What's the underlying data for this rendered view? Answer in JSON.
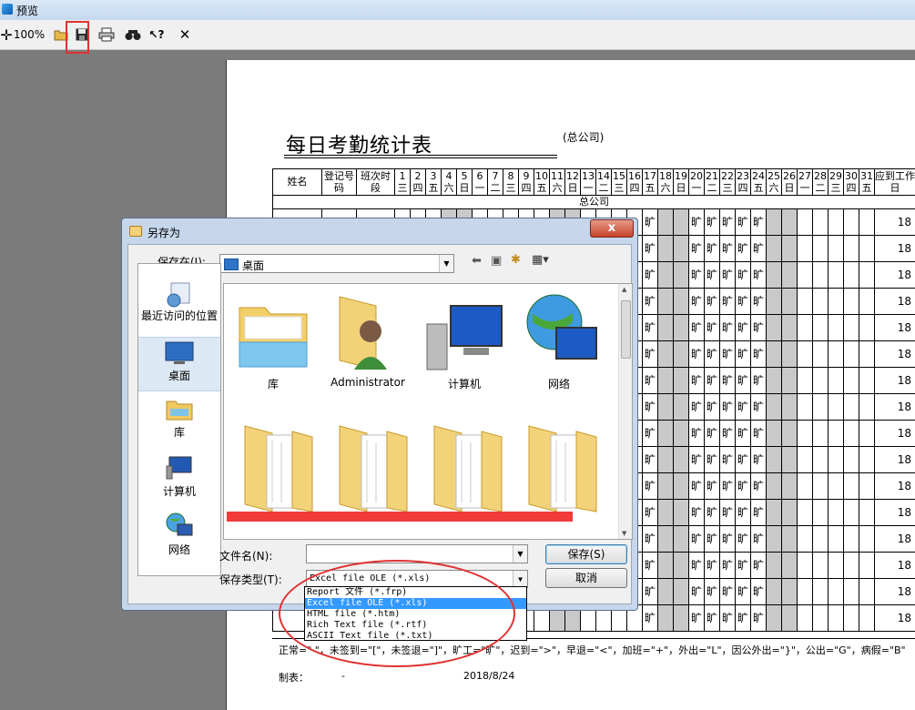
{
  "window": {
    "title": "预览"
  },
  "toolbar": {
    "zoom": "100%",
    "colors": {
      "highlight": "#e03131"
    }
  },
  "report": {
    "title": "每日考勤统计表",
    "subtitle": "(总公司)",
    "headers": {
      "name": "姓名",
      "reg_no": "登记号码",
      "shift": "班次时段",
      "days": [
        {
          "d": "1",
          "w": "三"
        },
        {
          "d": "2",
          "w": "四"
        },
        {
          "d": "3",
          "w": "五"
        },
        {
          "d": "4",
          "w": "六"
        },
        {
          "d": "5",
          "w": "日"
        },
        {
          "d": "6",
          "w": "一"
        },
        {
          "d": "7",
          "w": "二"
        },
        {
          "d": "8",
          "w": "三"
        },
        {
          "d": "9",
          "w": "四"
        },
        {
          "d": "10",
          "w": "五"
        },
        {
          "d": "11",
          "w": "六"
        },
        {
          "d": "12",
          "w": "日"
        },
        {
          "d": "13",
          "w": "一"
        },
        {
          "d": "14",
          "w": "二"
        },
        {
          "d": "15",
          "w": "三"
        },
        {
          "d": "16",
          "w": "四"
        },
        {
          "d": "17",
          "w": "五"
        },
        {
          "d": "18",
          "w": "六"
        },
        {
          "d": "19",
          "w": "日"
        },
        {
          "d": "20",
          "w": "一"
        },
        {
          "d": "21",
          "w": "二"
        },
        {
          "d": "22",
          "w": "三"
        },
        {
          "d": "23",
          "w": "四"
        },
        {
          "d": "24",
          "w": "五"
        },
        {
          "d": "25",
          "w": "六"
        },
        {
          "d": "26",
          "w": "日"
        },
        {
          "d": "27",
          "w": "一"
        },
        {
          "d": "28",
          "w": "二"
        },
        {
          "d": "29",
          "w": "三"
        },
        {
          "d": "30",
          "w": "四"
        },
        {
          "d": "31",
          "w": "五"
        }
      ],
      "required": "应到工作日"
    },
    "group": "总公司",
    "row_mark": "旷",
    "row_value": "18",
    "legend": "正常=\" \"，未签到=\"[\"，未签退=\"]\"，旷工=\"旷\"，迟到=\">\"，早退=\"<\"，加班=\"+\"，外出=\"L\"，因公外出=\"}\"，公出=\"G\"，病假=\"B\"",
    "maker_label": "制表：",
    "maker_value": "-",
    "date": "2018/8/24"
  },
  "dialog": {
    "title": "另存为",
    "save_in_label": "保存在(I):",
    "save_in_value": "桌面",
    "places": [
      "最近访问的位置",
      "桌面",
      "库",
      "计算机",
      "网络"
    ],
    "files": [
      "库",
      "Administrator",
      "计算机",
      "网络"
    ],
    "filename_label": "文件名(N):",
    "filename_value": "",
    "filetype_label": "保存类型(T):",
    "filetype_value": "Excel file OLE (*.xls)",
    "filetype_options": [
      "Report 文件 (*.frp)",
      "Excel file OLE (*.xls)",
      "HTML file (*.htm)",
      "Rich Text file (*.rtf)",
      "ASCII Text file (*.txt)"
    ],
    "save_button": "保存(S)",
    "cancel_button": "取消",
    "close_button": "x"
  }
}
